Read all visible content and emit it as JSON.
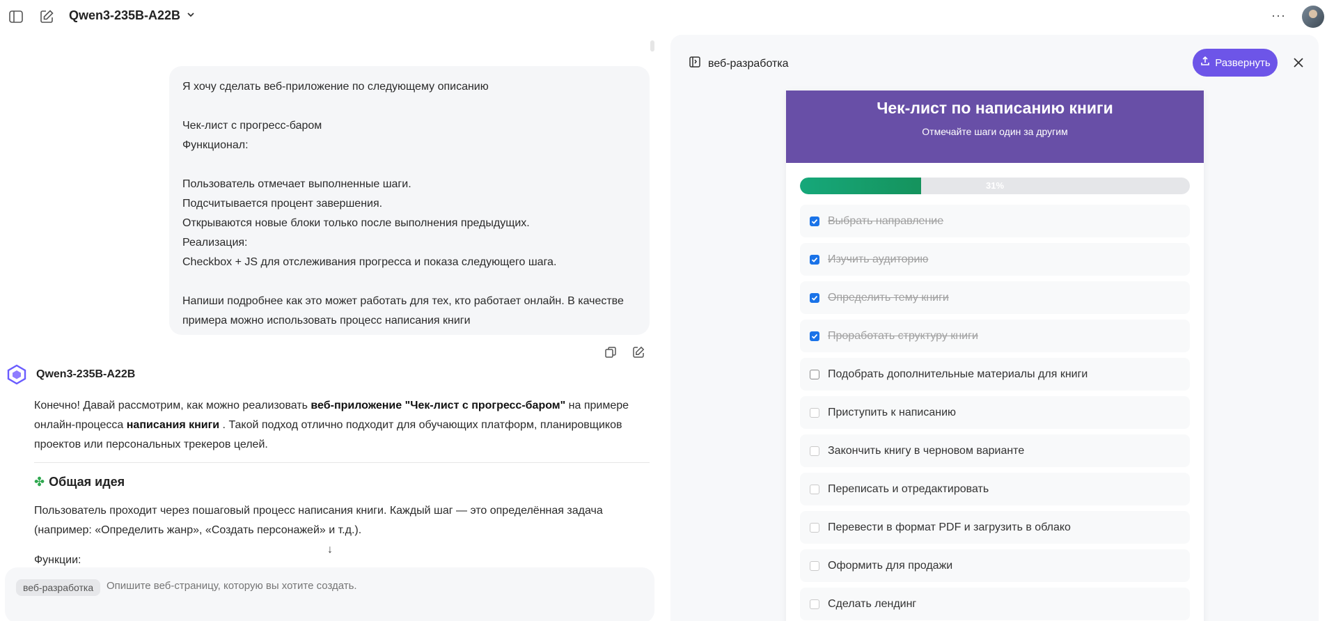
{
  "topbar": {
    "model_name": "Qwen3-235B-A22B",
    "more_label": "···"
  },
  "user_message": {
    "lines": [
      "Я хочу сделать веб-приложение по следующему описанию",
      "",
      "Чек-лист с прогресс-баром",
      "Функционал:",
      "",
      "Пользователь отмечает выполненные шаги.",
      "Подсчитывается процент завершения.",
      "Открываются новые блоки только после выполнения предыдущих.",
      "Реализация:",
      "Checkbox + JS для отслеживания прогресса и показа следующего шага.",
      "",
      "Напиши подробнее как это может работать для тех, кто работает онлайн. В качестве",
      "примера можно использовать процесс написания книги"
    ]
  },
  "assistant": {
    "name": "Qwen3-235B-A22B",
    "intro_p1_a": "Конечно! Давай рассмотрим, как можно реализовать ",
    "intro_p1_b": "веб-приложение \"Чек-лист с прогресс-баром\"",
    "intro_p1_c": " на примере",
    "intro_p2_a": "онлайн-процесса ",
    "intro_p2_b": "написания книги",
    "intro_p2_c": " . Такой подход отлично подходит для обучающих платформ, планировщиков",
    "intro_p3": "проектов или персональных трекеров целей.",
    "section_title": "Общая идея",
    "idea_line1": "Пользователь проходит через пошаговый процесс написания книги. Каждый шаг — это определённая задача",
    "idea_line2": "(например: «Определить жанр», «Создать персонажей» и т.д.).",
    "functions_label": "Функции:"
  },
  "input": {
    "tag": "веб-разработка",
    "placeholder": "Опишите веб-страницу, которую вы хотите создать."
  },
  "panel": {
    "title": "веб-разработка",
    "expand_label": "Развернуть"
  },
  "app": {
    "title": "Чек-лист по написанию книги",
    "subtitle": "Отмечайте шаги один за другим",
    "progress_percent": 31,
    "progress_label": "31%",
    "steps": [
      {
        "label": "Выбрать направление",
        "state": "done"
      },
      {
        "label": "Изучить аудиторию",
        "state": "done"
      },
      {
        "label": "Определить тему книги",
        "state": "done"
      },
      {
        "label": "Проработать структуру книги",
        "state": "done"
      },
      {
        "label": "Подобрать дополнительные материалы для книги",
        "state": "active"
      },
      {
        "label": "Приступить к написанию",
        "state": "locked"
      },
      {
        "label": "Закончить книгу в черновом варианте",
        "state": "locked"
      },
      {
        "label": "Переписать и отредактировать",
        "state": "locked"
      },
      {
        "label": "Перевести в формат PDF и загрузить в облако",
        "state": "locked"
      },
      {
        "label": "Оформить для продажи",
        "state": "locked"
      },
      {
        "label": "Сделать лендинг",
        "state": "locked"
      }
    ]
  }
}
